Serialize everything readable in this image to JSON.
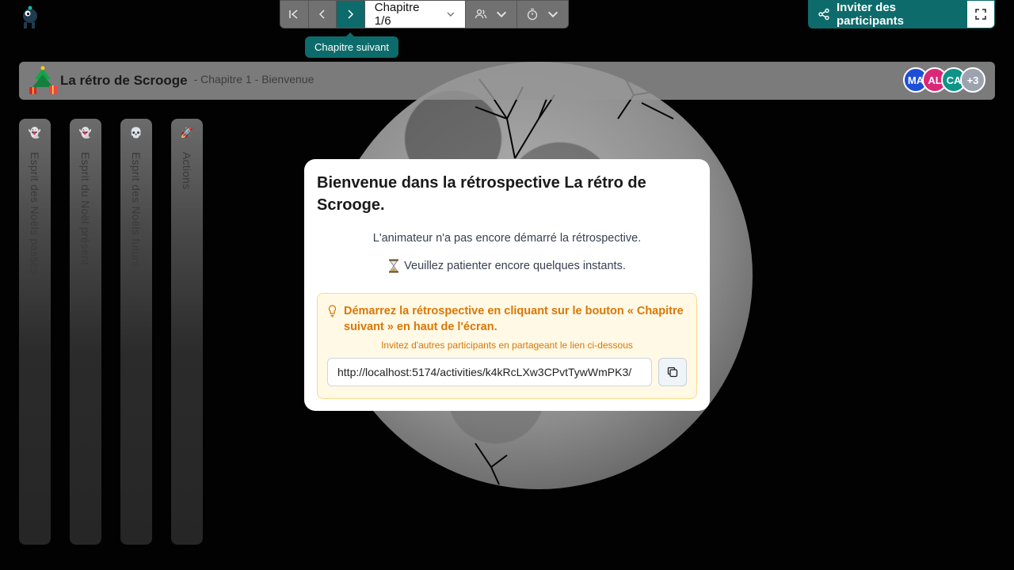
{
  "toolbar": {
    "chapter_label": "Chapitre 1/6",
    "icons": [
      "first-chapter-icon",
      "previous-icon",
      "next-icon",
      "users-icon",
      "timer-icon"
    ]
  },
  "tooltip": {
    "text": "Chapitre suivant"
  },
  "invite": {
    "label": "Inviter des participants"
  },
  "header": {
    "title": "La rétro de Scrooge",
    "subtitle": "- Chapitre 1 - Bienvenue",
    "avatars": [
      {
        "initials": "MA",
        "color": "#1d4ed8"
      },
      {
        "initials": "AL",
        "color": "#db2777"
      },
      {
        "initials": "CA",
        "color": "#0d9488"
      },
      {
        "initials": "+3",
        "color": "#9ca3af"
      }
    ]
  },
  "columns": [
    {
      "label": "Esprit des Noëls passés",
      "icon": "ghost-past-icon"
    },
    {
      "label": "Esprit du Noël présent",
      "icon": "ghost-present-icon"
    },
    {
      "label": "Esprit des Noëls futurs",
      "icon": "ghost-future-icon"
    },
    {
      "label": "Actions",
      "icon": "rocket-icon"
    }
  ],
  "modal": {
    "title": "Bienvenue dans la rétrospective La rétro de Scrooge.",
    "text": "L'animateur n'a pas encore démarré la rétrospective.",
    "wait_text": "Veuillez patienter encore quelques instants.",
    "tip_title": "Démarrez la rétrospective en cliquant sur le bouton « Chapitre suivant » en haut de l'écran.",
    "tip_sub": "Invitez d'autres participants en partageant le lien ci-dessous",
    "link": "http://localhost:5174/activities/k4kRcLXw3CPvtTywWmPK3/"
  },
  "colors": {
    "accent": "#0d6b6b",
    "warning": "#d97706"
  }
}
